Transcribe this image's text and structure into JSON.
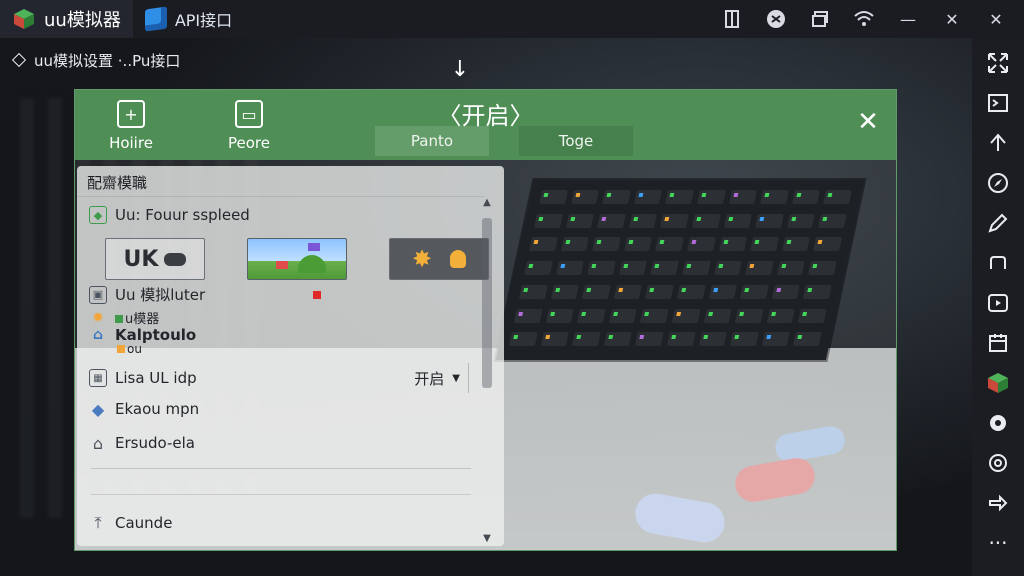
{
  "titlebar": {
    "tab_active_title": "uu模拟器",
    "tab_second_title": "API接口"
  },
  "subheader": {
    "text": "uu模拟设置 ·..Pu接口"
  },
  "dialog": {
    "title": "〈开启〉",
    "nav": [
      {
        "label": "Hoiire",
        "icon": "add-box-icon"
      },
      {
        "label": "Peore",
        "icon": "clipboard-icon"
      }
    ],
    "tabs": [
      "Panto",
      "Toge"
    ]
  },
  "panel": {
    "title": "配齋模職",
    "rows": {
      "row1": "Uu: Fouur sspleed",
      "row2": "Uu 模拟luter",
      "row3a": "u模器",
      "row3b": "Kalptoulo",
      "row3c": "ou",
      "select_label": "Lisa UL idp",
      "select_value": "开启",
      "row5": "Ekaou mpn",
      "row6": "Ersudo-ela",
      "row7": "Caunde"
    },
    "thumbs": {
      "uk_label": "UK"
    }
  },
  "icons": {
    "sidebar": [
      "expand-icon",
      "terminal-icon",
      "arrow-up-icon",
      "compass-icon",
      "pen-icon",
      "loop-icon",
      "video-icon",
      "calendar-icon",
      "app-cube-icon",
      "gear-icon",
      "settings-icon",
      "arrow-right-icon",
      "more-icon"
    ]
  },
  "colors": {
    "dialog_header": "#4f8f56",
    "brand_cube": "#2f8fe6"
  }
}
